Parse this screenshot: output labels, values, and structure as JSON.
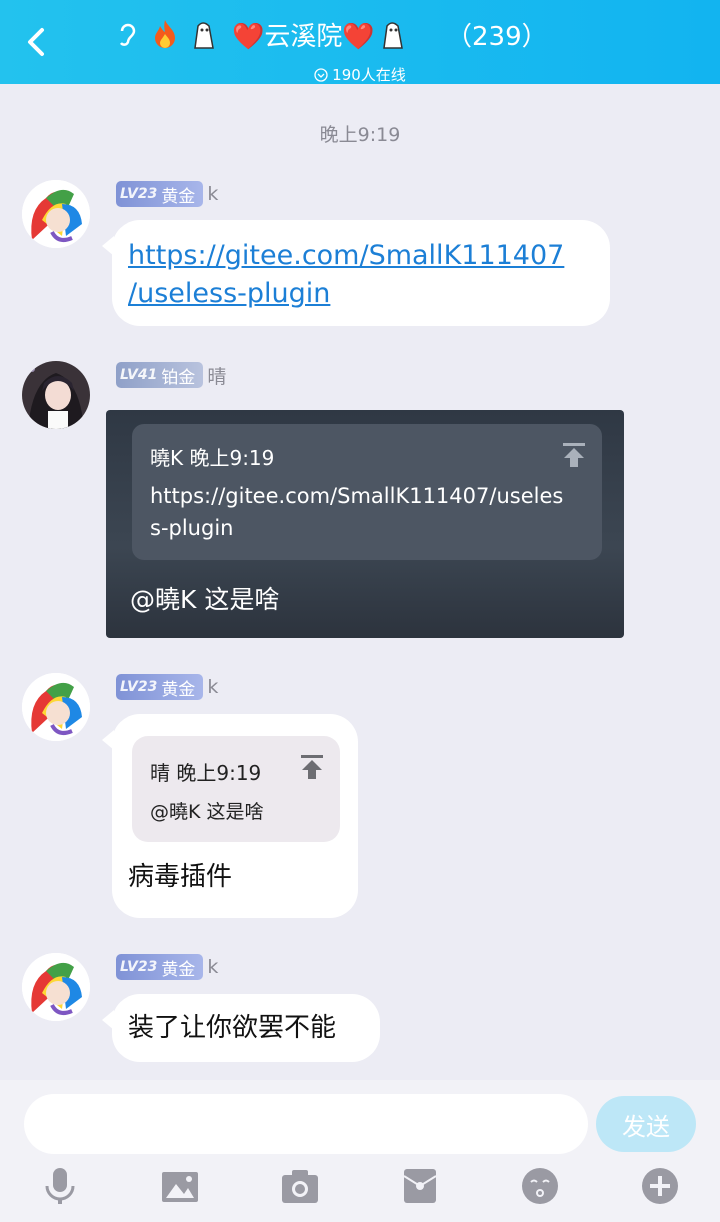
{
  "header": {
    "back_label": "back",
    "group_name": "❤️云溪院❤️",
    "member_count": "（239）",
    "online": "190人在线"
  },
  "timestamp": "晚上9:19",
  "messages": [
    {
      "badge_level": "LV23",
      "badge_title": "黄金",
      "nickname": "k",
      "text_line1": "https://gitee.com/SmallK111407",
      "text_line2": "/useless-plugin"
    },
    {
      "badge_level": "LV41",
      "badge_title": "铂金",
      "nickname": "晴",
      "quote_header": "曉K 晚上9:19",
      "quote_text": "https://gitee.com/SmallK111407/useless-plugin",
      "reply": "@曉K 这是啥"
    },
    {
      "badge_level": "LV23",
      "badge_title": "黄金",
      "nickname": "k",
      "quote_header": "晴 晚上9:19",
      "quote_text": "@曉K 这是啥",
      "text": "病毒插件"
    },
    {
      "badge_level": "LV23",
      "badge_title": "黄金",
      "nickname": "k",
      "text": "装了让你欲罢不能"
    }
  ],
  "input": {
    "placeholder": "",
    "send_label": "发送"
  },
  "toolbar": [
    "microphone-icon",
    "image-icon",
    "camera-icon",
    "red-packet-icon",
    "emoji-icon",
    "plus-icon"
  ],
  "colors": {
    "header": "#17b9ef",
    "link": "#1c7fd6",
    "send_button": "#bde7f7"
  }
}
